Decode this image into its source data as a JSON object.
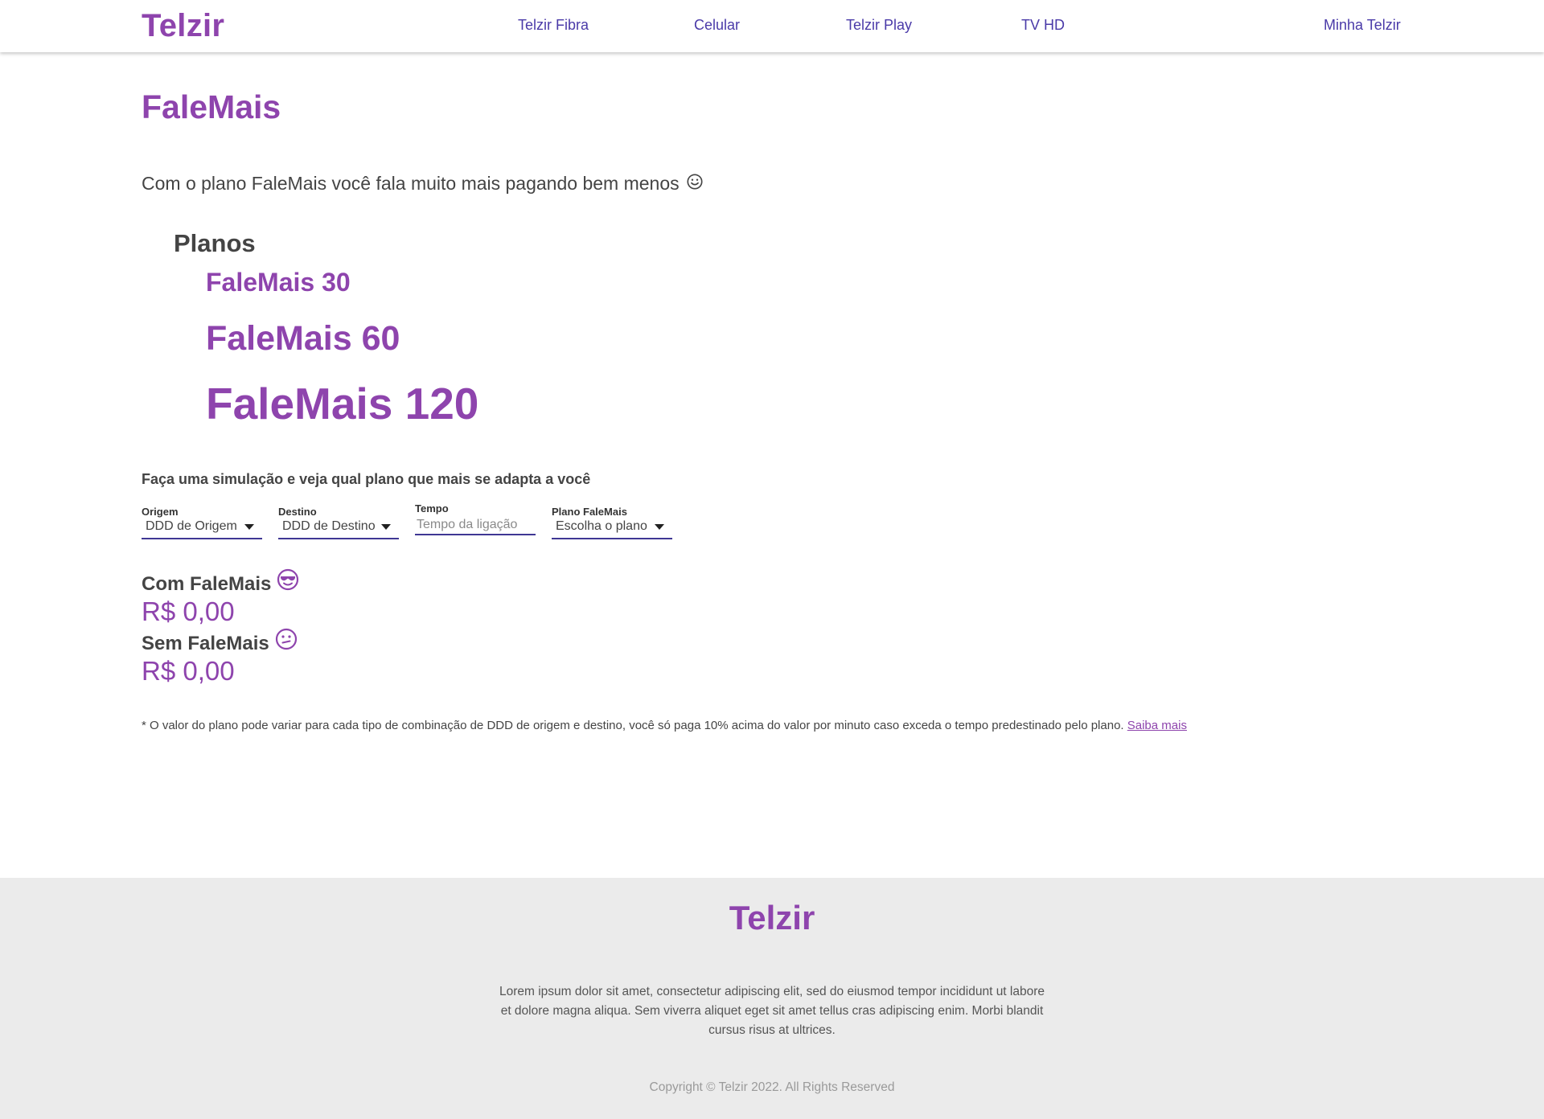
{
  "header": {
    "brand": "Telzir",
    "nav": [
      "Telzir Fibra",
      "Celular",
      "Telzir Play",
      "TV HD"
    ],
    "account_link": "Minha Telzir"
  },
  "main": {
    "title": "FaleMais",
    "intro": "Com o plano FaleMais você fala muito mais pagando bem menos",
    "plans_heading": "Planos",
    "plans": [
      "FaleMais 30",
      "FaleMais 60",
      "FaleMais 120"
    ],
    "simulation_title": "Faça uma simulação e veja qual plano que mais se adapta a você",
    "form": {
      "origem_label": "Origem",
      "origem_value": "DDD de Origem",
      "destino_label": "Destino",
      "destino_value": "DDD de Destino",
      "tempo_label": "Tempo",
      "tempo_placeholder": "Tempo da ligação",
      "plano_label": "Plano FaleMais",
      "plano_value": "Escolha o plano"
    },
    "results": {
      "com_label": "Com FaleMais",
      "com_value": "R$ 0,00",
      "com_icon": "cool-face-icon",
      "sem_label": "Sem FaleMais",
      "sem_value": "R$ 0,00",
      "sem_icon": "confused-face-icon"
    },
    "footnote": "* O valor do plano pode variar para cada tipo de combinação de DDD de origem e destino, você só paga 10% acima do valor por minuto caso exceda o tempo predestinado pelo plano.",
    "footnote_link": "Saiba mais"
  },
  "footer": {
    "brand": "Telzir",
    "text": "Lorem ipsum dolor sit amet, consectetur adipiscing elit, sed do eiusmod tempor incididunt ut labore et dolore magna aliqua. Sem viverra aliquet eget sit amet tellus cras adipiscing enim. Morbi blandit cursus risus at ultrices.",
    "copyright": "Copyright © Telzir 2022. All Rights Reserved"
  },
  "colors": {
    "brand_purple": "#8e44ad",
    "nav_indigo": "#4a3aa8",
    "underline": "#3f3794",
    "footer_bg": "#ebebeb"
  }
}
